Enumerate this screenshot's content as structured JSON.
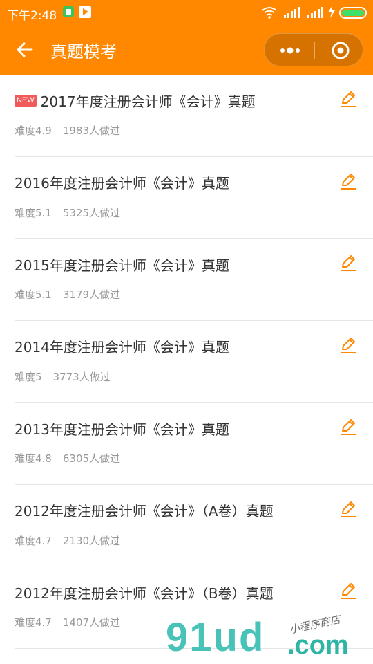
{
  "status_bar": {
    "time": "下午2:48"
  },
  "header": {
    "title": "真题模考",
    "accent_color": "#ff8800"
  },
  "items": [
    {
      "is_new": true,
      "badge": "NEW",
      "title": "2017年度注册会计师《会计》真题",
      "difficulty": "难度4.9",
      "count": "1983人做过"
    },
    {
      "is_new": false,
      "badge": "",
      "title": "2016年度注册会计师《会计》真题",
      "difficulty": "难度5.1",
      "count": "5325人做过"
    },
    {
      "is_new": false,
      "badge": "",
      "title": "2015年度注册会计师《会计》真题",
      "difficulty": "难度5.1",
      "count": "3179人做过"
    },
    {
      "is_new": false,
      "badge": "",
      "title": "2014年度注册会计师《会计》真题",
      "difficulty": "难度5",
      "count": "3773人做过"
    },
    {
      "is_new": false,
      "badge": "",
      "title": "2013年度注册会计师《会计》真题",
      "difficulty": "难度4.8",
      "count": "6305人做过"
    },
    {
      "is_new": false,
      "badge": "",
      "title": "2012年度注册会计师《会计》（A卷）真题",
      "difficulty": "难度4.7",
      "count": "2130人做过"
    },
    {
      "is_new": false,
      "badge": "",
      "title": "2012年度注册会计师《会计》（B卷）真题",
      "difficulty": "难度4.7",
      "count": "1407人做过"
    }
  ],
  "watermark": {
    "main": "91ud",
    "suffix": ".com",
    "tagline": "小程序商店"
  },
  "icons": {
    "back": "arrow-left-icon",
    "more": "more-dots-icon",
    "close": "target-close-icon",
    "edit": "pencil-icon"
  }
}
